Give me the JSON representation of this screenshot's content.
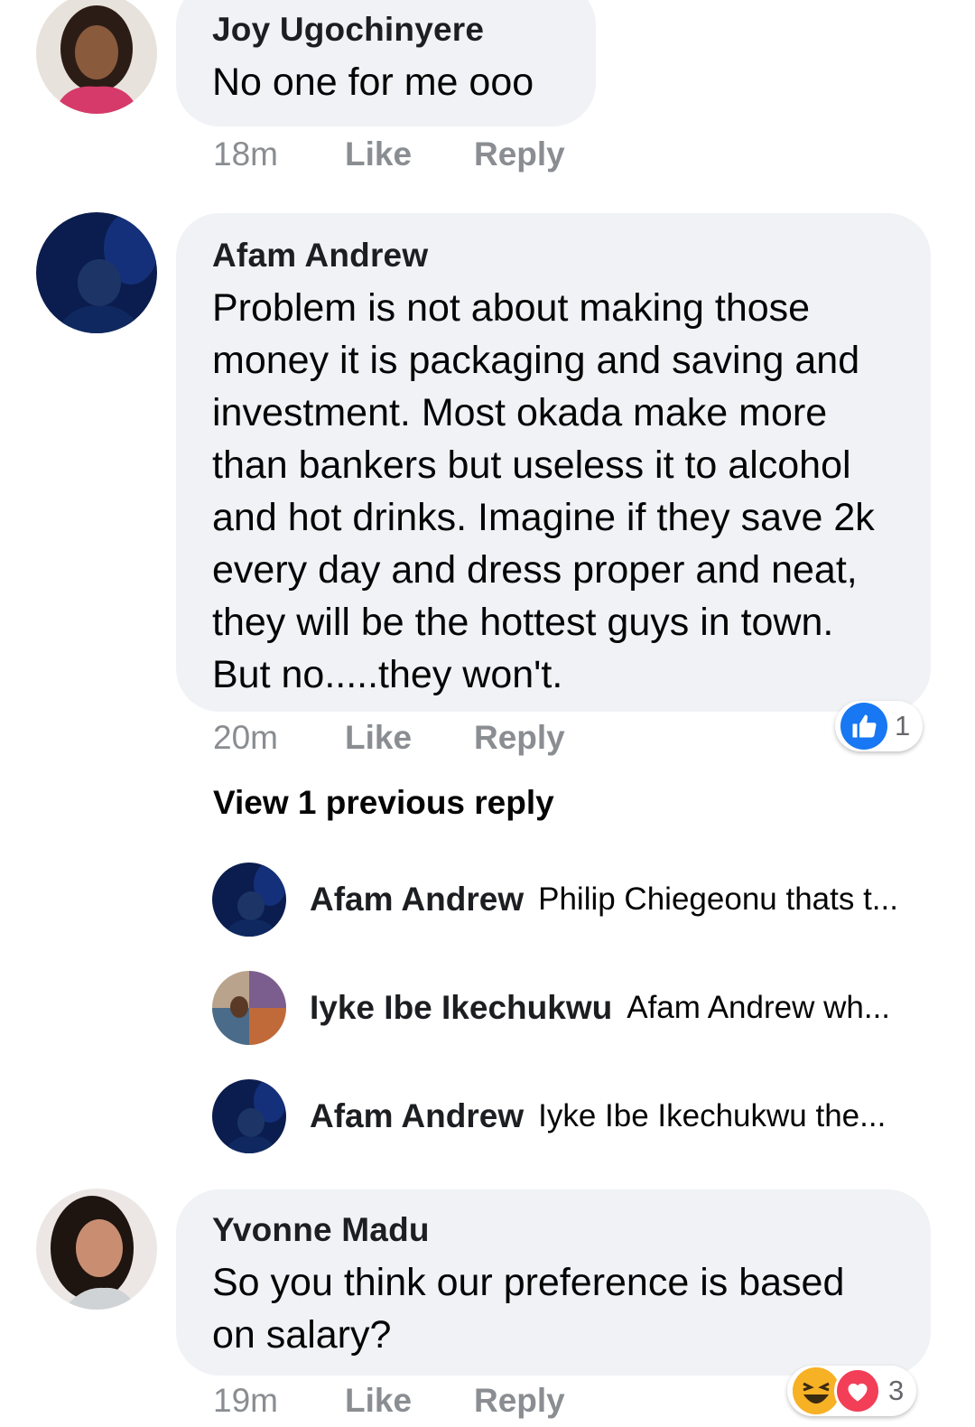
{
  "comments": [
    {
      "author": "Joy Ugochinyere",
      "text": "No one for me ooo",
      "time": "18m",
      "like_label": "Like",
      "reply_label": "Reply"
    },
    {
      "author": "Afam Andrew",
      "text": "Problem is not about making those money it is packaging and saving and investment. Most okada make more than bankers but useless it to alcohol and hot drinks. Imagine if they save 2k every day and dress proper and neat, they will be the hottest guys in town. But no.....they won't.",
      "time": "20m",
      "like_label": "Like",
      "reply_label": "Reply",
      "reaction_count": "1",
      "view_previous": "View 1 previous reply",
      "replies": [
        {
          "author": "Afam Andrew",
          "snippet": "Philip Chiegeonu thats t..."
        },
        {
          "author": "Iyke Ibe Ikechukwu",
          "snippet": "Afam Andrew wh..."
        },
        {
          "author": "Afam Andrew",
          "snippet": "Iyke Ibe Ikechukwu the..."
        }
      ]
    },
    {
      "author": "Yvonne Madu",
      "text": "So you think our preference is based on salary?",
      "time": "19m",
      "like_label": "Like",
      "reply_label": "Reply",
      "reaction_count": "3"
    }
  ],
  "colors": {
    "bubble": "#f0f2f5",
    "meta_text": "#8a8d91",
    "like_blue": "#1877f2",
    "love_red": "#f33e58",
    "haha_yellow": "#f7b125"
  },
  "icons": {
    "like_reaction": "thumbs-up-icon",
    "haha_reaction": "laughing-face-icon",
    "love_reaction": "heart-icon"
  }
}
